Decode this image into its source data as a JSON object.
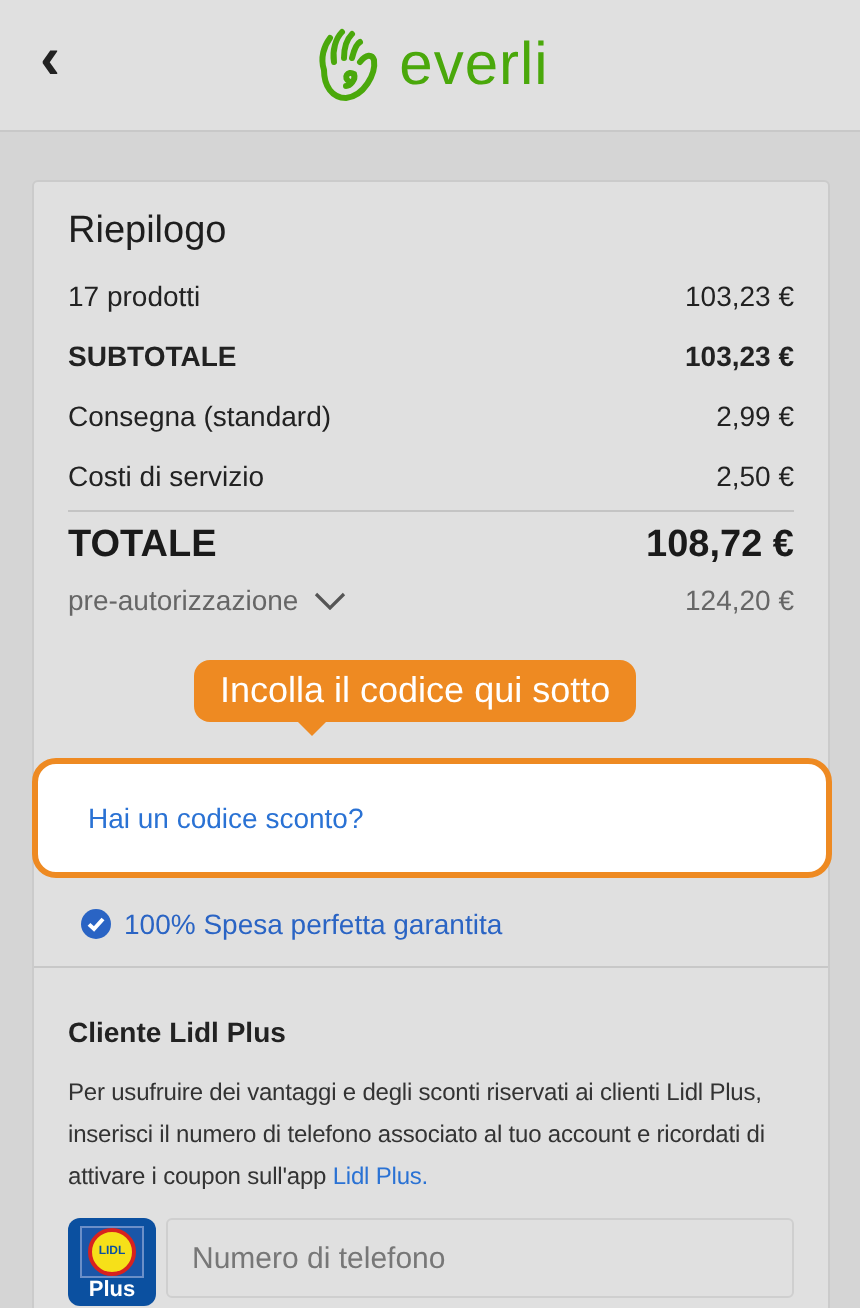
{
  "header": {
    "back": "‹",
    "brand": "everli"
  },
  "summary": {
    "title": "Riepilogo",
    "rows": [
      {
        "label": "17 prodotti",
        "value": "103,23 €",
        "kind": "normal"
      },
      {
        "label": "SUBTOTALE",
        "value": "103,23 €",
        "kind": "bold"
      },
      {
        "label": "Consegna (standard)",
        "value": "2,99 €",
        "kind": "normal"
      },
      {
        "label": "Costi di servizio",
        "value": "2,50 €",
        "kind": "normal"
      }
    ],
    "total": {
      "label": "TOTALE",
      "value": "108,72 €"
    },
    "preauth": {
      "label": "pre-autorizzazione",
      "value": "124,20 €",
      "expanded": false
    }
  },
  "tooltip": "Incolla il codice qui sotto",
  "discount_link": "Hai un codice sconto?",
  "guarantee": "100% Spesa perfetta garantita",
  "lidl": {
    "title": "Cliente Lidl Plus",
    "text": "Per usufruire dei vantaggi e degli sconti riservati ai clienti Lidl Plus, inserisci il numero di telefono associato al tuo account e ricordati di attivare i coupon sull'app ",
    "link": "Lidl Plus.",
    "logo_mark": "LIDL",
    "logo_label": "Plus",
    "phone_placeholder": "Numero di telefono"
  }
}
